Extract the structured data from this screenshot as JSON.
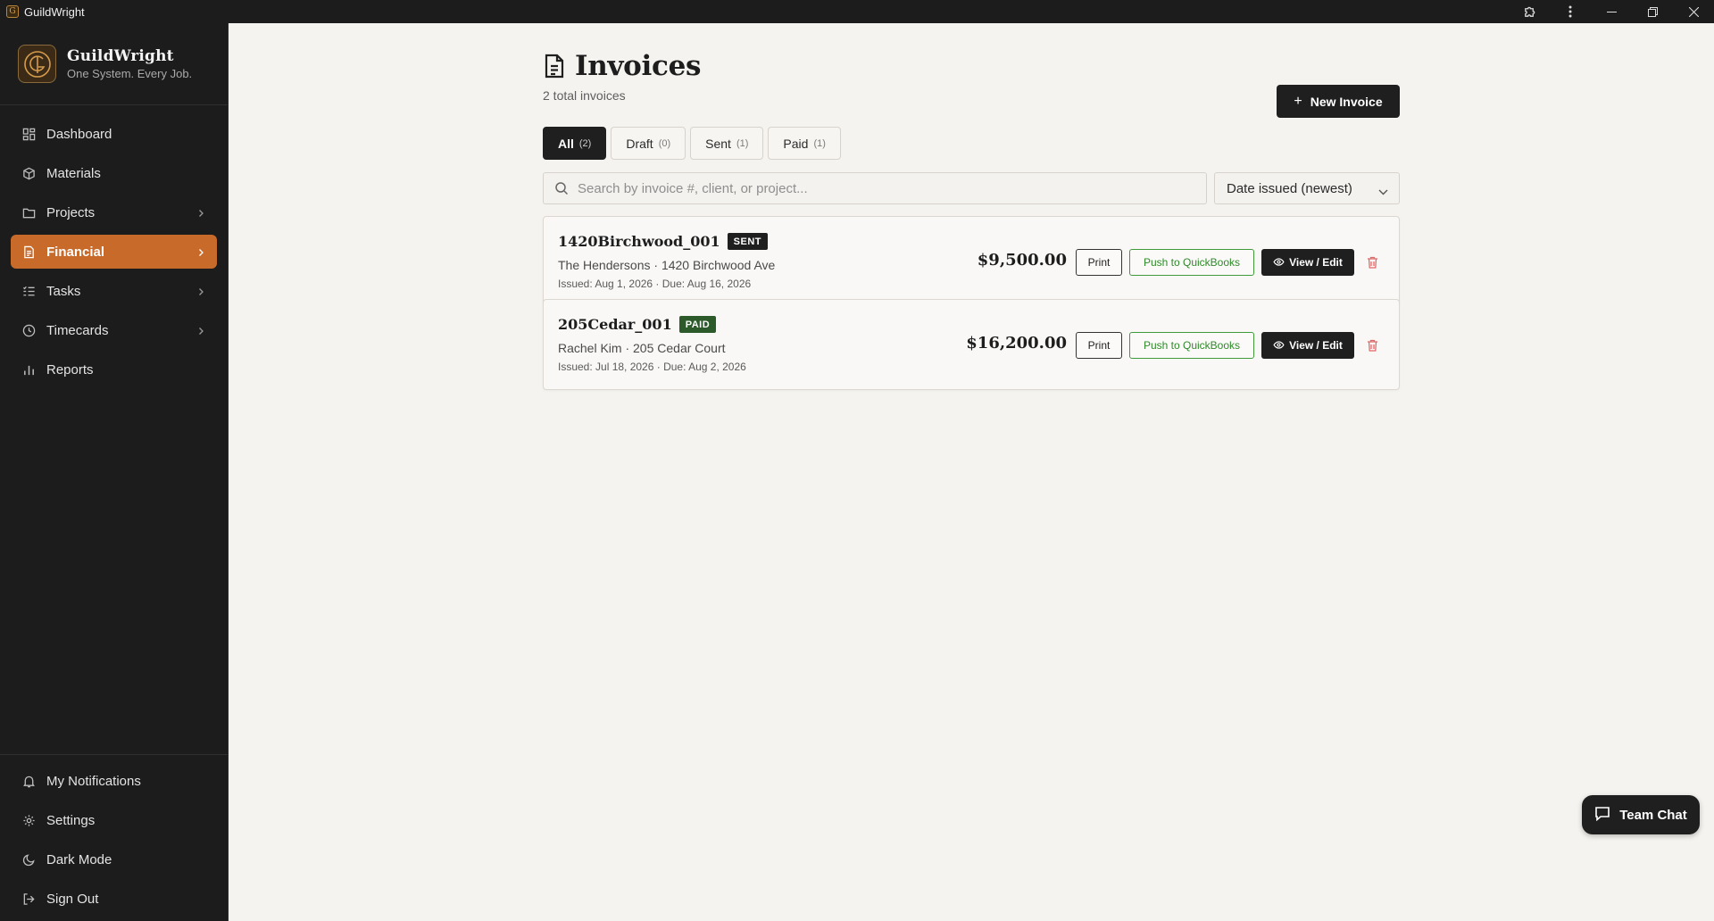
{
  "window": {
    "title": "GuildWright"
  },
  "brand": {
    "name": "GuildWright",
    "tagline": "One System. Every Job.",
    "accent_color": "#c86a2a"
  },
  "sidebar": {
    "items": [
      {
        "label": "Dashboard",
        "icon": "dashboard-grid-icon",
        "has_submenu": false,
        "active": false
      },
      {
        "label": "Materials",
        "icon": "box-icon",
        "has_submenu": false,
        "active": false
      },
      {
        "label": "Projects",
        "icon": "folder-icon",
        "has_submenu": true,
        "active": false
      },
      {
        "label": "Financial",
        "icon": "receipt-icon",
        "has_submenu": true,
        "active": true
      },
      {
        "label": "Tasks",
        "icon": "task-list-icon",
        "has_submenu": true,
        "active": false
      },
      {
        "label": "Timecards",
        "icon": "clock-icon",
        "has_submenu": true,
        "active": false
      },
      {
        "label": "Reports",
        "icon": "bar-chart-icon",
        "has_submenu": false,
        "active": false
      }
    ],
    "bottom_items": [
      {
        "label": "My Notifications",
        "icon": "bell-icon"
      },
      {
        "label": "Settings",
        "icon": "gear-icon"
      },
      {
        "label": "Dark Mode",
        "icon": "moon-icon"
      },
      {
        "label": "Sign Out",
        "icon": "sign-out-icon"
      }
    ]
  },
  "page": {
    "title": "Invoices",
    "subtitle": "2 total invoices",
    "new_button_label": "New Invoice"
  },
  "tabs": [
    {
      "label": "All",
      "count": "(2)",
      "active": true
    },
    {
      "label": "Draft",
      "count": "(0)",
      "active": false
    },
    {
      "label": "Sent",
      "count": "(1)",
      "active": false
    },
    {
      "label": "Paid",
      "count": "(1)",
      "active": false
    }
  ],
  "search": {
    "placeholder": "Search by invoice #, client, or project...",
    "value": ""
  },
  "sort": {
    "selected": "Date issued (newest)"
  },
  "invoices": [
    {
      "number": "1420Birchwood_001",
      "status": "SENT",
      "client_line": "The Hendersons · 1420 Birchwood Ave",
      "dates_line": "Issued: Aug 1, 2026 · Due: Aug 16, 2026",
      "amount": "$9,500.00",
      "status_color": "#1f1f1f"
    },
    {
      "number": "205Cedar_001",
      "status": "PAID",
      "client_line": "Rachel Kim · 205 Cedar Court",
      "dates_line": "Issued: Jul 18, 2026 · Due: Aug 2, 2026",
      "amount": "$16,200.00",
      "status_color": "#2c5a2a"
    }
  ],
  "invoice_actions": {
    "print_label": "Print",
    "quickbooks_label": "Push to QuickBooks",
    "view_label": "View / Edit"
  },
  "chat": {
    "label": "Team Chat"
  }
}
